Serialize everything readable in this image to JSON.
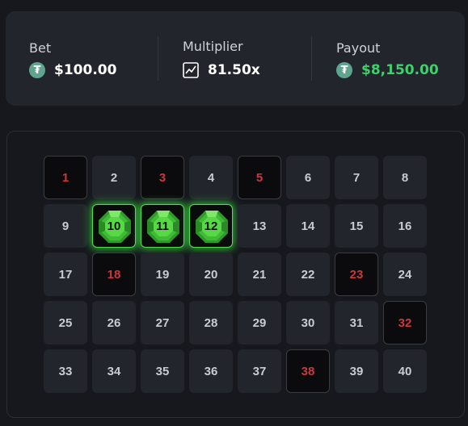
{
  "summary": {
    "bet": {
      "label": "Bet",
      "value": "$100.00",
      "icon": "tether-coin-icon"
    },
    "multiplier": {
      "label": "Multiplier",
      "value": "81.50x",
      "icon": "chart-line-icon"
    },
    "payout": {
      "label": "Payout",
      "value": "$8,150.00",
      "icon": "tether-coin-icon"
    }
  },
  "colors": {
    "background": "#16181d",
    "panel": "#22252c",
    "tile": "#22252b",
    "red_number": "#c63a3e",
    "selected_glow": "#4ee04a",
    "payout_green": "#3fcf6c",
    "coin": "#5fa58e"
  },
  "board": {
    "columns": 8,
    "tiles": [
      {
        "n": "1",
        "state": "red"
      },
      {
        "n": "2",
        "state": "normal"
      },
      {
        "n": "3",
        "state": "red"
      },
      {
        "n": "4",
        "state": "normal"
      },
      {
        "n": "5",
        "state": "red"
      },
      {
        "n": "6",
        "state": "normal"
      },
      {
        "n": "7",
        "state": "normal"
      },
      {
        "n": "8",
        "state": "normal"
      },
      {
        "n": "9",
        "state": "normal"
      },
      {
        "n": "10",
        "state": "selected"
      },
      {
        "n": "11",
        "state": "selected"
      },
      {
        "n": "12",
        "state": "selected"
      },
      {
        "n": "13",
        "state": "normal"
      },
      {
        "n": "14",
        "state": "normal"
      },
      {
        "n": "15",
        "state": "normal"
      },
      {
        "n": "16",
        "state": "normal"
      },
      {
        "n": "17",
        "state": "normal"
      },
      {
        "n": "18",
        "state": "red"
      },
      {
        "n": "19",
        "state": "normal"
      },
      {
        "n": "20",
        "state": "normal"
      },
      {
        "n": "21",
        "state": "normal"
      },
      {
        "n": "22",
        "state": "normal"
      },
      {
        "n": "23",
        "state": "red"
      },
      {
        "n": "24",
        "state": "normal"
      },
      {
        "n": "25",
        "state": "normal"
      },
      {
        "n": "26",
        "state": "normal"
      },
      {
        "n": "27",
        "state": "normal"
      },
      {
        "n": "28",
        "state": "normal"
      },
      {
        "n": "29",
        "state": "normal"
      },
      {
        "n": "30",
        "state": "normal"
      },
      {
        "n": "31",
        "state": "normal"
      },
      {
        "n": "32",
        "state": "red"
      },
      {
        "n": "33",
        "state": "normal"
      },
      {
        "n": "34",
        "state": "normal"
      },
      {
        "n": "35",
        "state": "normal"
      },
      {
        "n": "36",
        "state": "normal"
      },
      {
        "n": "37",
        "state": "normal"
      },
      {
        "n": "38",
        "state": "red"
      },
      {
        "n": "39",
        "state": "normal"
      },
      {
        "n": "40",
        "state": "normal"
      }
    ]
  }
}
